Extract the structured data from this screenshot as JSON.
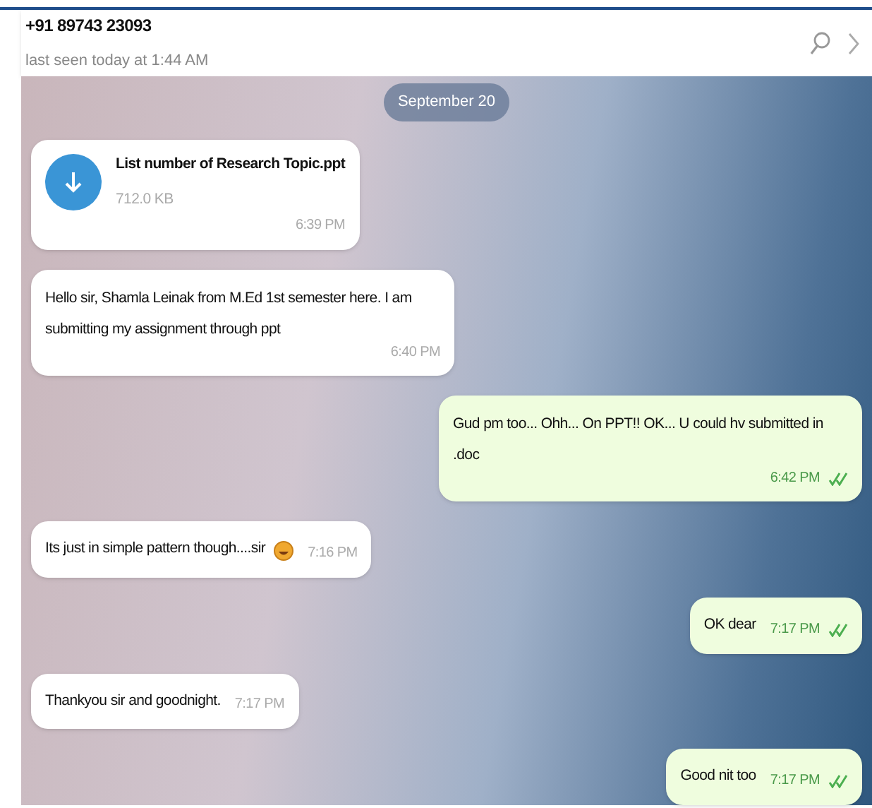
{
  "header": {
    "title": "+91 89743 23093",
    "status": "last seen today at 1:44 AM"
  },
  "date_label": "September 20",
  "messages": [
    {
      "kind": "file",
      "outgoing": false,
      "file_name": "List number of Research Topic.ppt",
      "size": "712.0 KB",
      "time": "6:39 PM"
    },
    {
      "kind": "text",
      "outgoing": false,
      "text": "Hello sir, Shamla Leinak from M.Ed 1st semester here. I am submitting my assignment through ppt",
      "time": "6:40 PM"
    },
    {
      "kind": "text",
      "outgoing": true,
      "text": "Gud pm too... Ohh... On PPT!!  OK...  U could hv submitted in .doc",
      "time": "6:42 PM",
      "read": true
    },
    {
      "kind": "text",
      "outgoing": false,
      "text": "Its just in simple pattern though....sir",
      "emoji": true,
      "time": "7:16 PM"
    },
    {
      "kind": "text",
      "outgoing": true,
      "text": "OK dear",
      "time": "7:17 PM",
      "read": true
    },
    {
      "kind": "text",
      "outgoing": false,
      "text": "Thankyou sir and goodnight.",
      "time": "7:17 PM"
    },
    {
      "kind": "text",
      "outgoing": true,
      "text": "Good nit too",
      "time": "7:17 PM",
      "read": true
    }
  ]
}
